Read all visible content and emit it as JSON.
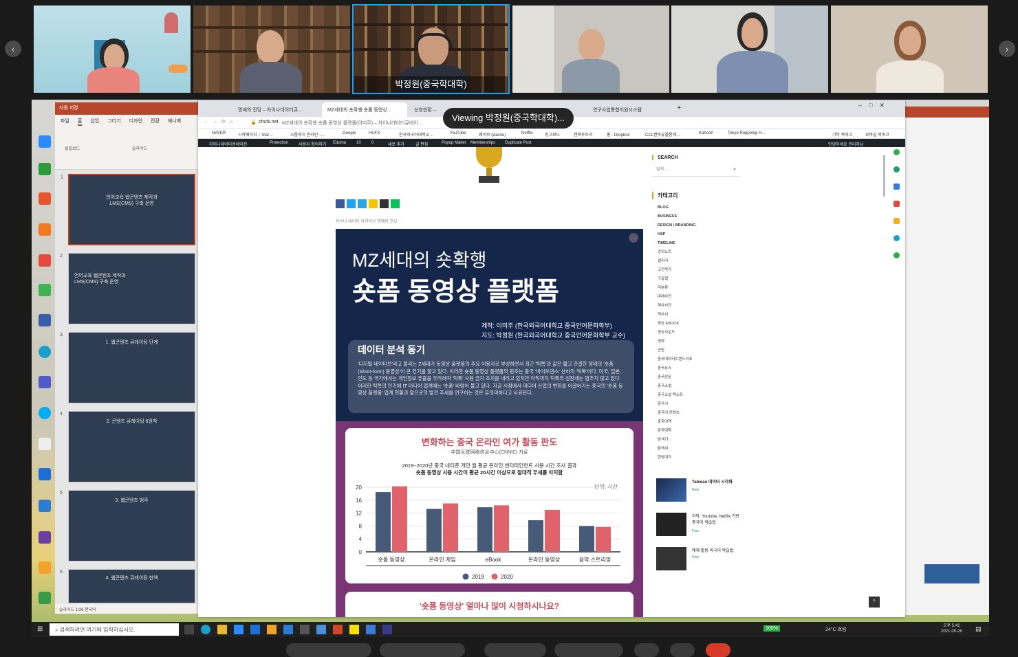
{
  "participants": [
    {
      "name": ""
    },
    {
      "name": ""
    },
    {
      "name": "박정원(중국학대학)"
    },
    {
      "name": ""
    },
    {
      "name": ""
    },
    {
      "name": ""
    }
  ],
  "viewing_label": "Viewing 박정원(중국학대학)...",
  "ppt": {
    "title_bar": "자동 저장",
    "tabs": [
      "파일",
      "홈",
      "삽입",
      "그리기",
      "디자인",
      "전환",
      "애니메"
    ],
    "ribbon_groups": [
      "클립보드",
      "슬라이드"
    ],
    "slides": [
      {
        "num": "1",
        "title": "언어교육 웹콘텐츠 제작과\nLMS(CMS) 구축 운영"
      },
      {
        "num": "2",
        "title": "언어교육 웹콘텐츠 제작과\nLMS(CMS) 구축 운영"
      },
      {
        "num": "3",
        "title": "1. 웹콘텐츠 큐레이팅 단계"
      },
      {
        "num": "4",
        "title": "2. 콘텐츠 큐레이팅 6원칙"
      },
      {
        "num": "5",
        "title": "3. 웹콘텐츠 범주"
      },
      {
        "num": "6",
        "title": "4. 웹콘텐츠 큐레이팅 현액"
      }
    ],
    "status": "슬라이드 1/26   한국어"
  },
  "browser": {
    "tabs": [
      "명예의 전당 – 차이나데이터큐…",
      "MZ세대의 숏확행 숏폼 동영상…",
      "신청현황 –",
      "연구사업통합지원시스템"
    ],
    "url_host": "chufs.net",
    "url_title": "MZ세대의 숏확행 숏폼 동영상 플랫폼(이미주) – 차이나데이터큐레이…",
    "bookmarks": [
      "NAVER",
      "시작페이지 :: Star…",
      "스톱워치 온라인 -…",
      "Google",
      "HUFS",
      "한국외국어대학교…",
      "YouTube",
      "웨이브 (wavve)",
      "Netflix",
      "망고보드",
      "캔바투트리",
      "홈 - Dropbox",
      "CCL캔바뷰폴통계…",
      "Kahoot!",
      "Tokyo Roppongi H…",
      "기타 북마크",
      "모바일 북마크"
    ],
    "wpbar": [
      "차이나데이터큐레이션",
      "Protection",
      "사용자 정의하기",
      "Eduma",
      "10",
      "0",
      "새로 추가",
      "글 편집",
      "Popup Maker",
      "Memberships",
      "Duplicate Post",
      "안녕하세요 관리자님"
    ]
  },
  "article": {
    "breadcrumb": "차이나 데이터 아카이브 명예의 전당",
    "hero_title_1": "MZ세대의 숏확행",
    "hero_title_2": "숏폼 동영상 플랫폼",
    "credit_1": "제작: 이미주 (한국외국어대학교 중국언어문화학부)",
    "credit_2": "지도: 박정원 (한국외국어대학교 중국언어문화학부 교수)",
    "motive_title": "데이터 분석 동기",
    "motive_body": "'디지털 네이티브'라고 불리는 Z세대가 동영상 플랫폼의 주요 이용자로 부상하면서 최근 '틱톡'과 같은 짧고 간결한 형태의 '숏폼(Short-form) 동영상'이 큰 인기를 끌고 있다. 이러한 숏폼 동영상 플랫폼의 원조는 중국 '바이트댄스' 산하의 '틱톡'이다. 미국, 일본, 인도 등 국가에서는 개인정보 유출을 우려하며 '틱톡' 사용 금지 조치를 내리고 있지만 아직까지 틱톡의 성장세는 멈추지 않고 있다. 이러한 틱톡의 인기에 IT 미디어 업계에는 '숏폼' 바람이 불고 있다. 지금 시점에서 미디어 산업의 변화를 이끌어가는 중국의 '숏폼 동영상 플랫폼' 업계 현황과 앞으로의 발전 추세를 연구하는 것은 유의미하다고 사료된다.",
    "chart_title": "변화하는 중국 온라인 여가 활동 판도",
    "chart_source": "中国互联网络信息中心(CNNIC) 자료",
    "chart_desc_1": "2019~2020년 중국 네티즌 개인 월 평균 온라인 엔터테인먼트 사용 시간 조사 결과",
    "chart_desc_2": "숏폼 동영상 사용 시간이 평균 20시간 이상으로 절대적 우세를 차지함",
    "chart_unit": "단위: 시간",
    "section2_title": "'숏폼 동영상' 얼마나 많이 시청하시나요?"
  },
  "chart_data": {
    "type": "bar",
    "categories": [
      "숏폼 동영상",
      "온라인 게임",
      "eBook",
      "온라인 동영상",
      "음악 스트리밍"
    ],
    "series": [
      {
        "name": "2019",
        "values": [
          18.5,
          13.3,
          13.8,
          9.8,
          8.0
        ]
      },
      {
        "name": "2020",
        "values": [
          20.3,
          15.0,
          14.4,
          13.0,
          7.7
        ]
      }
    ],
    "ylim": [
      0,
      20
    ],
    "yticks": [
      "0",
      "4",
      "8",
      "12",
      "16",
      "20"
    ],
    "colors": [
      "#475a78",
      "#e0636b"
    ]
  },
  "sidebar": {
    "search_title": "SEARCH",
    "search_placeholder": "검색 …",
    "cat_title": "카테고리",
    "categories": [
      "BLOG",
      "BUSINESS",
      "DESIGN / BRANDING",
      "HSP",
      "TIMELINE",
      "강의노트",
      "갤러리",
      "고전작가",
      "구글맵",
      "미분류",
      "미래사전",
      "역사사전",
      "역사서",
      "영상 EBOOK",
      "영상사운드",
      "영화",
      "인단",
      "중국데이터트렌드리포",
      "중국뉴스",
      "중국산문",
      "중국소설",
      "중국소설 텍스트",
      "중국시",
      "중국어 콘텐츠",
      "중국어책",
      "중국대학",
      "탐색기",
      "탐색서",
      "한당대가"
    ],
    "courses": [
      {
        "title": "Tableau 데이터 시각화",
        "price": "Free"
      },
      {
        "title": "자막, Youtube, Netflix 기반 중국어 학습법",
        "price": "Free"
      },
      {
        "title": "매체 활용 외국어 학습법",
        "price": "Free"
      }
    ]
  },
  "taskbar": {
    "search_placeholder": "검색하려면 여기에 입력하십시오.",
    "battery": "100%",
    "weather": "24°C 흐림",
    "time": "오후 5:42",
    "date": "2021-09-28"
  }
}
